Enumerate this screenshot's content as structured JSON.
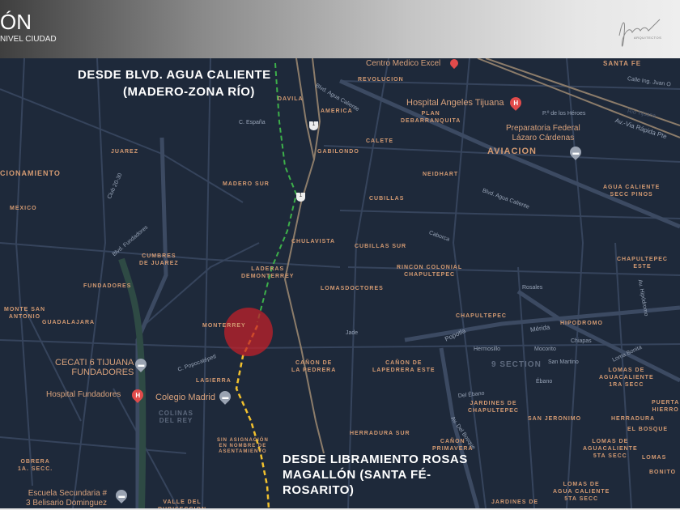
{
  "header": {
    "title_fragment": "ÓN",
    "subtitle_fragment": "NIVEL CIUDAD",
    "logo_text": "ARQUITECTOS"
  },
  "overlays": {
    "route_north": [
      "DESDE BLVD. AGUA CALIENTE",
      "(MADERO-ZONA RÍO)"
    ],
    "route_south": [
      "DESDE LIBRAMIENTO ROSAS",
      "MAGALLÓN (SANTA FÉ-",
      "ROSARITO)"
    ]
  },
  "colors": {
    "map_bg": "#1e293a",
    "road": "#36445c",
    "highway": "#8c7c6a",
    "north_route": "#3db04a",
    "south_route": "#f2c12e",
    "target_circle": "#c0202a",
    "label": "#d39a72"
  },
  "pois": [
    {
      "name": "Centro Medico Excel",
      "icon": "map-pin-icon"
    },
    {
      "name": "Hospital Angeles Tijuana",
      "icon": "hospital-icon"
    },
    {
      "name": "Preparatoria Federal\nLázaro Cárdenas",
      "icon": "school-icon"
    },
    {
      "name": "CECATI 6 TIJUANA\nFUNDADORES",
      "icon": "school-icon"
    },
    {
      "name": "Hospital Fundadores",
      "icon": "hospital-icon"
    },
    {
      "name": "Colegio Madrid",
      "icon": "school-icon"
    },
    {
      "name": "Escuela Secundaria #\n3 Belisario Dominguez",
      "icon": "school-icon"
    }
  ],
  "neighborhoods": [
    "SANTA FE",
    "REVOLUCION",
    "PLAN\nDEBARRANQUITA",
    "AVIACION",
    "CALETE",
    "GABILONDO",
    "NEIDHART",
    "CUBILLAS",
    "AGUA CALIENTE\nSECC PINOS",
    "CUBILLAS SUR",
    "RINCON COLONIAL\nCHAPULTEPEC",
    "CHAPULTEPEC\nESTE",
    "DAVILA",
    "AMERICA",
    "JUAREZ",
    "CIONAMIENTO",
    "MADERO SUR",
    "MEXICO",
    "CHULAVISTA",
    "CUMBRES\nDE JUAREZ",
    "LADERAS\nDEMONTERREY",
    "LOMASDOCTORES",
    "FUNDADORES",
    "MONTE SAN\nANTONIO",
    "GUADALAJARA",
    "MONTERREY",
    "CHAPULTEPEC",
    "HIPODROMO",
    "LASIERRA",
    "CAÑON DE\nLA PEDRERA",
    "CAÑON DE\nLAPEDRERA ESTE",
    "9 SECTION",
    "LOMAS DE\nAGUACALIENTE\n1RA SECC",
    "COLINAS\nDEL REY",
    "JARDINES DE\nCHAPULTEPEC",
    "SAN JERONIMO",
    "HERRADURA",
    "PUERTA\nHIERRO",
    "EL BOSQUE",
    "HERRADURA SUR",
    "SIN ASIGNACIÓN\nEN NOMBRE DE\nASENTAMIENTO",
    "CAÑON\nPRIMAVERA",
    "LOMAS DE\nAGUACALIENTE\n5TA SECC",
    "LOMAS",
    "BONITO",
    "OBRERA\n1A. SECC.",
    "VALLE DEL\nRUBISECCION",
    "LOMAS DE\nAGUA CALIENTE\n5TA SECC",
    "JARDINES DE"
  ],
  "streets": [
    "Blvd. Agua Caliente",
    "Av.-Via Rápida Pte",
    "P.º de los Héroes",
    "Blvd. Fundadores",
    "Club 20-30",
    "C. España",
    "Caborca",
    "Popotla",
    "Mérida",
    "Chiapas",
    "Hermosillo",
    "Mocorito",
    "San Martino",
    "Ébano",
    "Del Ébano",
    "Av. Del Bosque",
    "Jade",
    "C. Popocatépetl",
    "Calle Ing. Juan O",
    "Río Tijuana",
    "Av. Hipódromo",
    "Loma Bonita",
    "Rosales",
    "Blvd. Agua Caliente"
  ],
  "highway_shields": [
    "1",
    "1"
  ]
}
